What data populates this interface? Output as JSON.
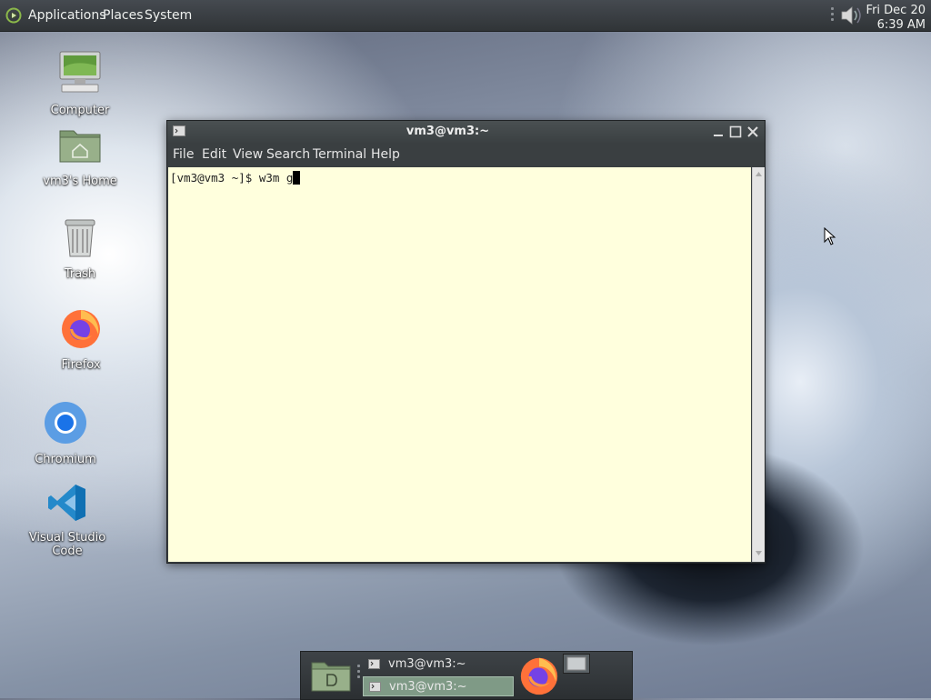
{
  "top_panel": {
    "menus": [
      "Applications",
      "Places",
      "System"
    ],
    "clock": {
      "date": "Fri Dec 20",
      "time": "6:39 AM"
    }
  },
  "desktop": {
    "icons": [
      {
        "label": "Computer",
        "icon": "computer-icon"
      },
      {
        "label": "vm3's Home",
        "icon": "home-folder-icon"
      },
      {
        "label": "Trash",
        "icon": "trash-icon"
      },
      {
        "label": "Firefox",
        "icon": "firefox-icon"
      },
      {
        "label": "Chromium",
        "icon": "chromium-icon"
      },
      {
        "label": "Visual Studio Code",
        "icon": "vscode-icon"
      }
    ]
  },
  "terminal": {
    "title": "vm3@vm3:~",
    "menu": [
      "File",
      "Edit",
      "View",
      "Search",
      "Terminal",
      "Help"
    ],
    "prompt": "[vm3@vm3 ~]$ w3m g"
  },
  "taskbar": {
    "tasks": [
      {
        "label": "vm3@vm3:~",
        "active": false
      },
      {
        "label": "vm3@vm3:~",
        "active": true
      }
    ]
  },
  "colors": {
    "terminal_bg": "#ffffdd",
    "panel": "#303437",
    "active_task": "#7f9a86"
  }
}
